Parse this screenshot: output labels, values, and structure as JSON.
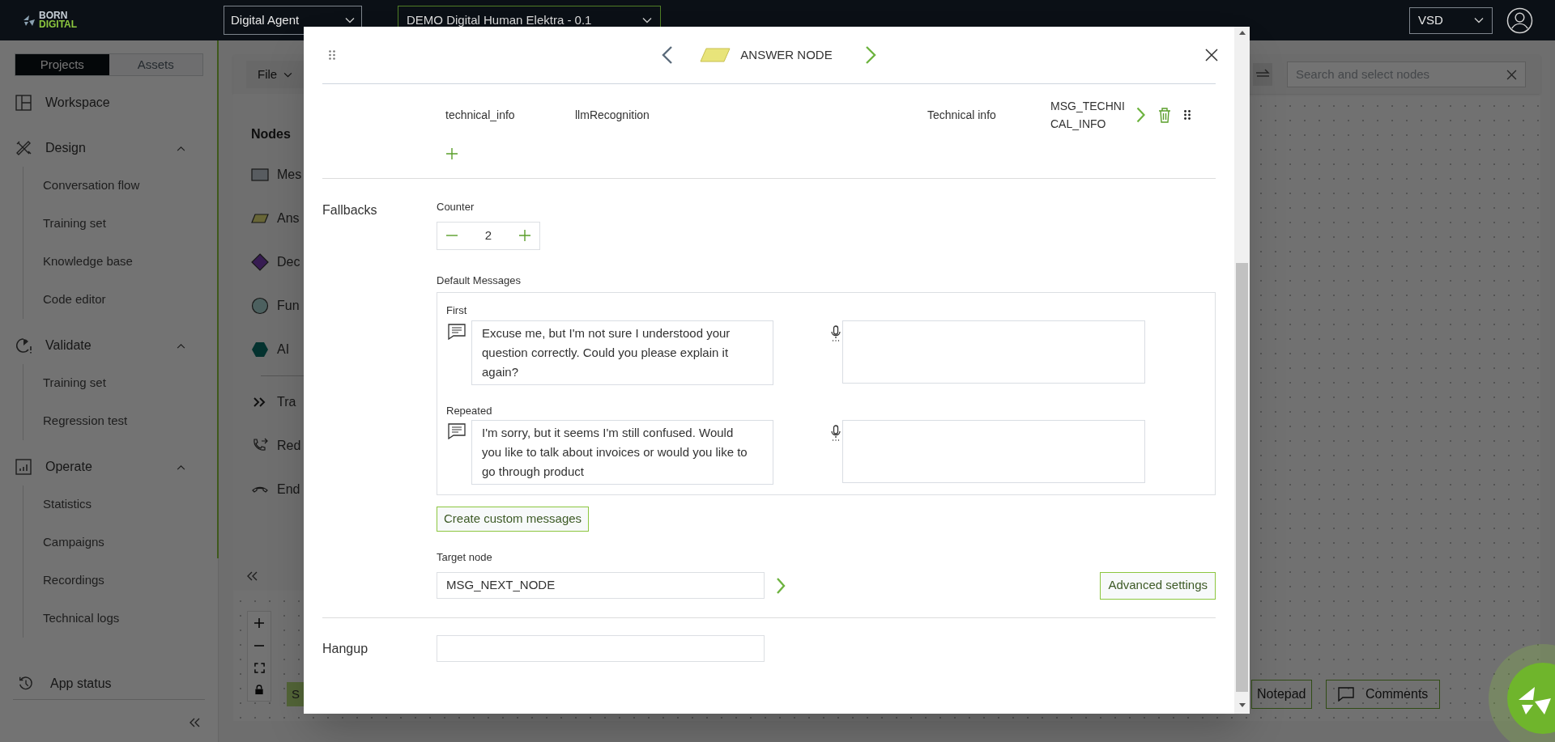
{
  "top_bar": {
    "logo_lines": [
      "BORN",
      "DIGITAL"
    ],
    "agent_select": "Digital Agent",
    "project_select": "DEMO Digital Human Elektra - 0.1",
    "user_select": "VSD"
  },
  "sidebar": {
    "tabs": [
      {
        "label": "Projects",
        "selected": true
      },
      {
        "label": "Assets",
        "selected": false
      }
    ],
    "sections": [
      {
        "label": "Workspace"
      },
      {
        "label": "Design",
        "expanded": true,
        "children": [
          "Conversation flow",
          "Training set",
          "Knowledge base",
          "Code editor"
        ]
      },
      {
        "label": "Validate",
        "expanded": true,
        "children": [
          "Training set",
          "Regression test"
        ]
      },
      {
        "label": "Operate",
        "expanded": true,
        "children": [
          "Statistics",
          "Campaigns",
          "Recordings",
          "Technical logs"
        ]
      }
    ],
    "app_status": "App status"
  },
  "canvas": {
    "file_menu": "File",
    "nodes_title": "Nodes",
    "node_types": [
      {
        "kind": "message",
        "label": "Mes"
      },
      {
        "kind": "answer",
        "label": "Ans"
      },
      {
        "kind": "decision",
        "label": "Dec"
      },
      {
        "kind": "function",
        "label": "Fun"
      },
      {
        "kind": "ai",
        "label": "AI"
      },
      {
        "kind": "transfer",
        "label": "Tra"
      },
      {
        "kind": "redirect",
        "label": "Red"
      },
      {
        "kind": "end",
        "label": "End"
      }
    ],
    "search": {
      "placeholder": "Search and select nodes"
    },
    "start_button": "S",
    "notepad_button": "Notepad",
    "comments_button": "Comments"
  },
  "modal": {
    "title": "ANSWER NODE",
    "intents": [
      {
        "name": "technical_info",
        "recognition": "llmRecognition",
        "label": "Technical info",
        "target": "MSG_TECHNICAL_INFO"
      }
    ],
    "fallbacks": {
      "label": "Fallbacks",
      "counter_label": "Counter",
      "counter": "2",
      "default_messages_label": "Default Messages",
      "messages": [
        {
          "label": "First",
          "text": "Excuse me, but I'm not sure I understood your question correctly. Could you please explain it again?"
        },
        {
          "label": "Repeated",
          "text": "I'm sorry, but it seems I'm still confused. Would you like to talk about invoices or would you like to go through product"
        }
      ],
      "create_button": "Create custom messages",
      "target_label": "Target node",
      "target_value": "MSG_NEXT_NODE",
      "advanced_button": "Advanced settings"
    },
    "hangup": {
      "label": "Hangup"
    }
  }
}
